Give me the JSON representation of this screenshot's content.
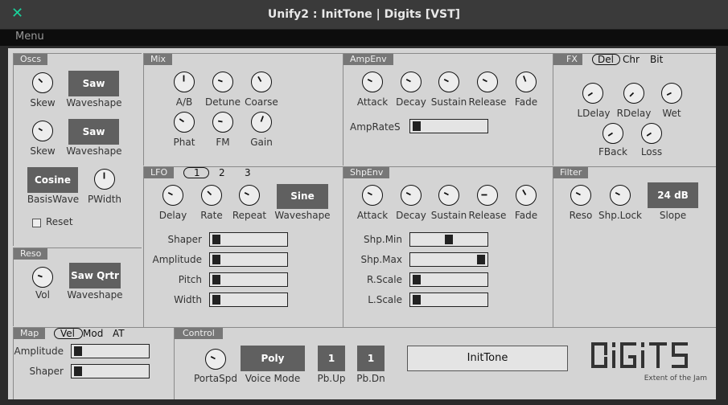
{
  "window": {
    "title": "Unify2 : InitTone | Digits [VST]",
    "close_glyph": "✕"
  },
  "menubar": {
    "menu": "Menu"
  },
  "oscs": {
    "title": "Oscs",
    "skew1": "Skew",
    "wave1_btn": "Saw",
    "wave1_lbl": "Waveshape",
    "skew2": "Skew",
    "wave2_btn": "Saw",
    "wave2_lbl": "Waveshape",
    "basis_btn": "Cosine",
    "basis_lbl": "BasisWave",
    "pwidth": "PWidth",
    "reset": "Reset"
  },
  "reso": {
    "title": "Reso",
    "vol": "Vol",
    "wave_btn": "Saw Qrtr",
    "wave_lbl": "Waveshape"
  },
  "mix": {
    "title": "Mix",
    "ab": "A/B",
    "detune": "Detune",
    "coarse": "Coarse",
    "phat": "Phat",
    "fm": "FM",
    "gain": "Gain"
  },
  "ampenv": {
    "title": "AmpEnv",
    "attack": "Attack",
    "decay": "Decay",
    "sustain": "Sustain",
    "release": "Release",
    "fade": "Fade",
    "ratelbl": "AmpRateS"
  },
  "fx": {
    "title": "FX",
    "tab1": "Del",
    "tab2": "Chr",
    "tab3": "Bit",
    "ldelay": "LDelay",
    "rdelay": "RDelay",
    "wet": "Wet",
    "fback": "FBack",
    "loss": "Loss"
  },
  "lfo": {
    "title": "LFO",
    "tab1": "1",
    "tab2": "2",
    "tab3": "3",
    "delay": "Delay",
    "rate": "Rate",
    "repeat": "Repeat",
    "wave_btn": "Sine",
    "wave_lbl": "Waveshape",
    "shaper": "Shaper",
    "amplitude": "Amplitude",
    "pitch": "Pitch",
    "width": "Width"
  },
  "shpenv": {
    "title": "ShpEnv",
    "attack": "Attack",
    "decay": "Decay",
    "sustain": "Sustain",
    "release": "Release",
    "fade": "Fade",
    "shpmin": "Shp.Min",
    "shpmax": "Shp.Max",
    "rscale": "R.Scale",
    "lscale": "L.Scale"
  },
  "filter": {
    "title": "Filter",
    "reso": "Reso",
    "shplock": "Shp.Lock",
    "slope_btn": "24 dB",
    "slope_lbl": "Slope"
  },
  "map": {
    "title": "Map",
    "tab1": "Vel",
    "tab2": "Mod",
    "tab3": "AT",
    "amplitude": "Amplitude",
    "shaper": "Shaper"
  },
  "control": {
    "title": "Control",
    "portaspd": "PortaSpd",
    "voice_btn": "Poly",
    "voice_lbl": "Voice Mode",
    "pbup_btn": "1",
    "pbup_lbl": "Pb.Up",
    "pbdn_btn": "1",
    "pbdn_lbl": "Pb.Dn",
    "preset": "InitTone"
  },
  "brand": {
    "logo": "DIGITS",
    "tagline": "Extent of the Jam"
  }
}
